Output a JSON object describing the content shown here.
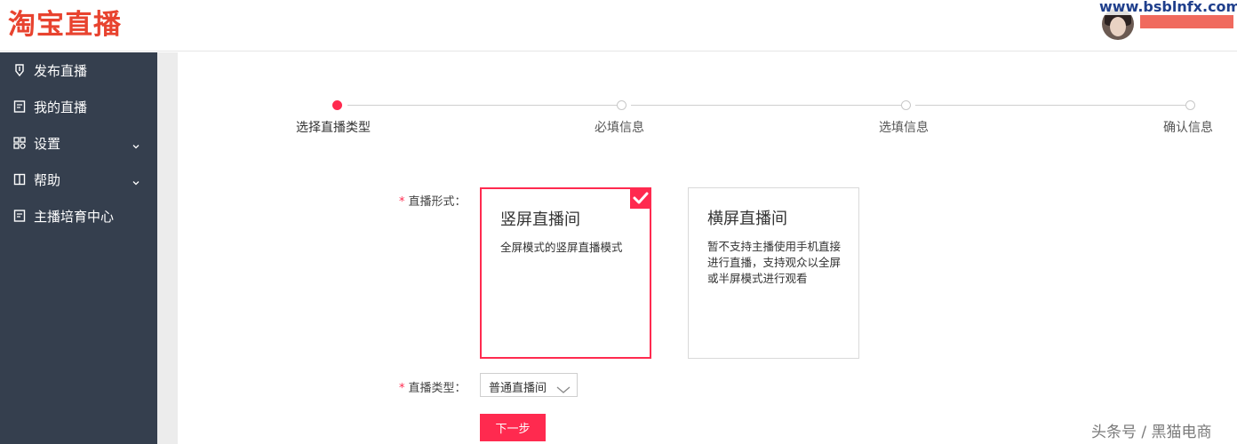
{
  "header": {
    "logo_text": "淘宝直播",
    "watermark_url": "www.bsblnfx.com"
  },
  "sidebar": {
    "items": [
      {
        "label": "发布直播",
        "icon": "publish-icon"
      },
      {
        "label": "我的直播",
        "icon": "document-icon"
      },
      {
        "label": "设置",
        "icon": "grid-settings-icon",
        "has_submenu": true
      },
      {
        "label": "帮助",
        "icon": "book-icon",
        "has_submenu": true
      },
      {
        "label": "主播培育中心",
        "icon": "document-icon"
      }
    ]
  },
  "steps": [
    {
      "label": "选择直播类型",
      "active": true
    },
    {
      "label": "必填信息",
      "active": false
    },
    {
      "label": "选填信息",
      "active": false
    },
    {
      "label": "确认信息",
      "active": false
    }
  ],
  "form": {
    "required_mark": "*",
    "format_label": "直播形式：",
    "options": [
      {
        "title": "竖屏直播间",
        "description": "全屏模式的竖屏直播模式",
        "selected": true
      },
      {
        "title": "横屏直播间",
        "description": "暂不支持主播使用手机直接进行直播，支持观众以全屏或半屏模式进行观看",
        "selected": false
      }
    ],
    "type_label": "直播类型：",
    "type_value": "普通直播间",
    "next_button": "下一步"
  },
  "watermark": "头条号 / 黑猫电商",
  "colors": {
    "accent": "#ff2a4f",
    "logo": "#e8432f",
    "sidebar_bg": "#353f4e"
  }
}
